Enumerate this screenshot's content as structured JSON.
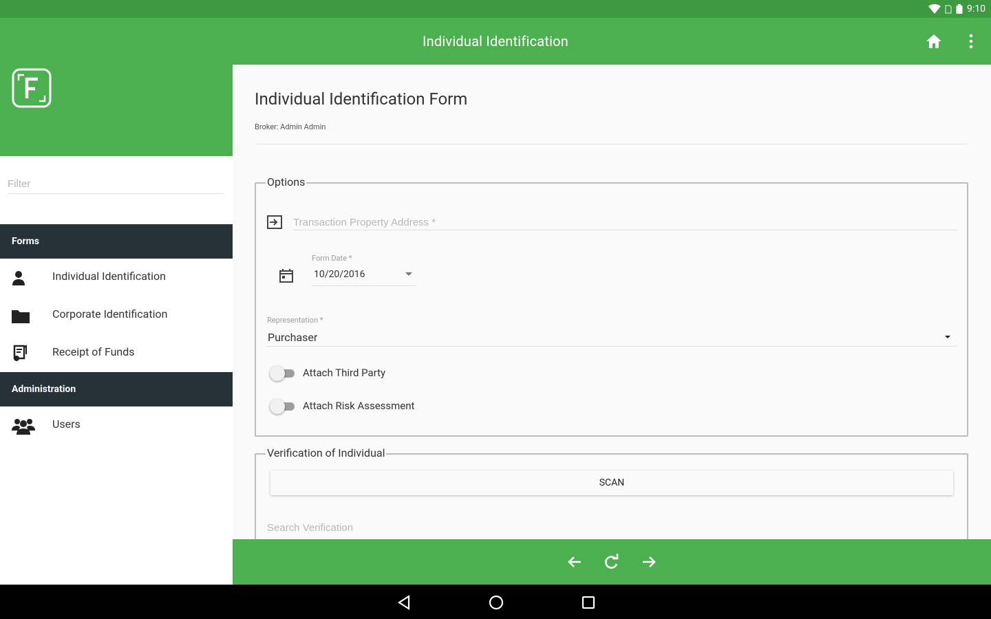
{
  "status_bar": {
    "time": "9:10"
  },
  "app_bar": {
    "title": "Individual Identification"
  },
  "sidebar": {
    "filter_placeholder": "Filter",
    "sections": {
      "forms": "Forms",
      "administration": "Administration"
    },
    "items": [
      {
        "label": "Individual Identification",
        "icon": "person-icon"
      },
      {
        "label": "Corporate Identification",
        "icon": "folder-icon"
      },
      {
        "label": "Receipt of Funds",
        "icon": "receipt-icon"
      },
      {
        "label": "Users",
        "icon": "users-icon"
      }
    ]
  },
  "form": {
    "title": "Individual Identification Form",
    "broker": "Broker: Admin Admin",
    "options": {
      "legend": "Options",
      "address_placeholder": "Transaction Property Address *",
      "form_date_label": "Form Date *",
      "form_date_value": "10/20/2016",
      "representation_label": "Representation *",
      "representation_value": "Purchaser",
      "attach_third_party": "Attach Third Party",
      "attach_risk_assessment": "Attach Risk Assessment"
    },
    "verification": {
      "legend": "Verification of Individual",
      "scan_label": "SCAN",
      "search_placeholder": "Search Verification"
    }
  },
  "colors": {
    "primary": "#4caf50",
    "status_bar": "#3d9a41",
    "section_header": "#263238"
  }
}
